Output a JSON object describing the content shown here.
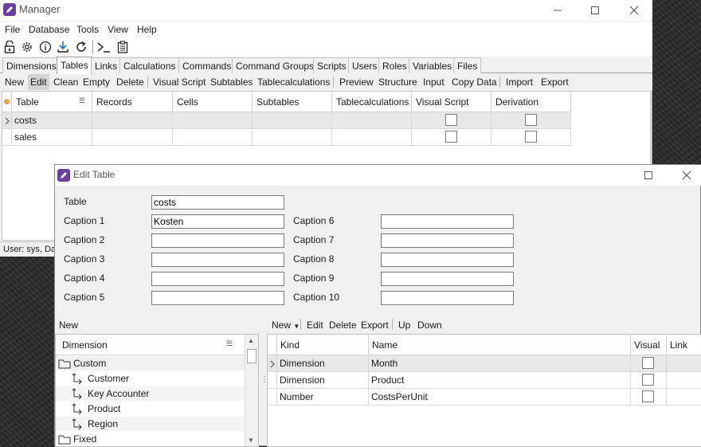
{
  "colors": {
    "accent": "#6b3fa0",
    "selected_row": "#e8e8e8",
    "active_tab_bg": "#ffffff"
  },
  "main_window": {
    "title": "Manager",
    "controls": {
      "minimize_icon": "minimize-icon",
      "maximize_icon": "maximize-icon",
      "close_icon": "close-icon"
    },
    "menu": [
      "File",
      "Database",
      "Tools",
      "View",
      "Help"
    ],
    "toolbar_icons": [
      "lock-open-icon",
      "gear-icon",
      "info-icon",
      "download-icon",
      "refresh-icon",
      "terminal-icon",
      "clipboard-icon"
    ],
    "tabs": [
      "Dimensions",
      "Tables",
      "Links",
      "Calculations",
      "Commands",
      "Command Groups",
      "Scripts",
      "Users",
      "Roles",
      "Variables",
      "Files"
    ],
    "active_tab": "Tables",
    "actions": [
      "New",
      "Edit",
      "Clean",
      "Empty",
      "Delete",
      "Visual Script",
      "Subtables",
      "Tablecalculations",
      "Preview",
      "Structure",
      "Input",
      "Copy Data",
      "Import",
      "Export"
    ],
    "grid": {
      "columns": [
        "Table",
        "Records",
        "Cells",
        "Subtables",
        "Tablecalculations",
        "Visual Script",
        "Derivation"
      ],
      "rows": [
        {
          "table": "costs",
          "records": "",
          "cells": "",
          "subtables": "",
          "tablecalculations": "",
          "visual_script": false,
          "derivation": false
        },
        {
          "table": "sales",
          "records": "",
          "cells": "",
          "subtables": "",
          "tablecalculations": "",
          "visual_script": false,
          "derivation": false
        }
      ]
    },
    "status": "User: sys, Dat"
  },
  "edit_dialog": {
    "title": "Edit Table",
    "table_label": "Table",
    "table_value": "costs",
    "captions": [
      {
        "label": "Caption 1",
        "value": "Kosten"
      },
      {
        "label": "Caption 2",
        "value": ""
      },
      {
        "label": "Caption 3",
        "value": ""
      },
      {
        "label": "Caption 4",
        "value": ""
      },
      {
        "label": "Caption 5",
        "value": ""
      },
      {
        "label": "Caption 6",
        "value": ""
      },
      {
        "label": "Caption 7",
        "value": ""
      },
      {
        "label": "Caption 8",
        "value": ""
      },
      {
        "label": "Caption 9",
        "value": ""
      },
      {
        "label": "Caption 10",
        "value": ""
      }
    ],
    "left_panel": {
      "new_label": "New",
      "column_header": "Dimension",
      "tree": [
        {
          "label": "Custom",
          "type": "folder",
          "level": 0
        },
        {
          "label": "Customer",
          "type": "dimension",
          "level": 1
        },
        {
          "label": "Key Accounter",
          "type": "dimension",
          "level": 1
        },
        {
          "label": "Product",
          "type": "dimension",
          "level": 1
        },
        {
          "label": "Region",
          "type": "dimension",
          "level": 1
        },
        {
          "label": "Fixed",
          "type": "folder",
          "level": 0
        }
      ]
    },
    "right_panel": {
      "actions": [
        "New",
        "Edit",
        "Delete",
        "Export",
        "Up",
        "Down"
      ],
      "columns": [
        "Kind",
        "Name",
        "Visual",
        "Link"
      ],
      "rows": [
        {
          "kind": "Dimension",
          "name": "Month",
          "visual": false
        },
        {
          "kind": "Dimension",
          "name": "Product",
          "visual": false
        },
        {
          "kind": "Number",
          "name": "CostsPerUnit",
          "visual": false
        }
      ]
    }
  }
}
